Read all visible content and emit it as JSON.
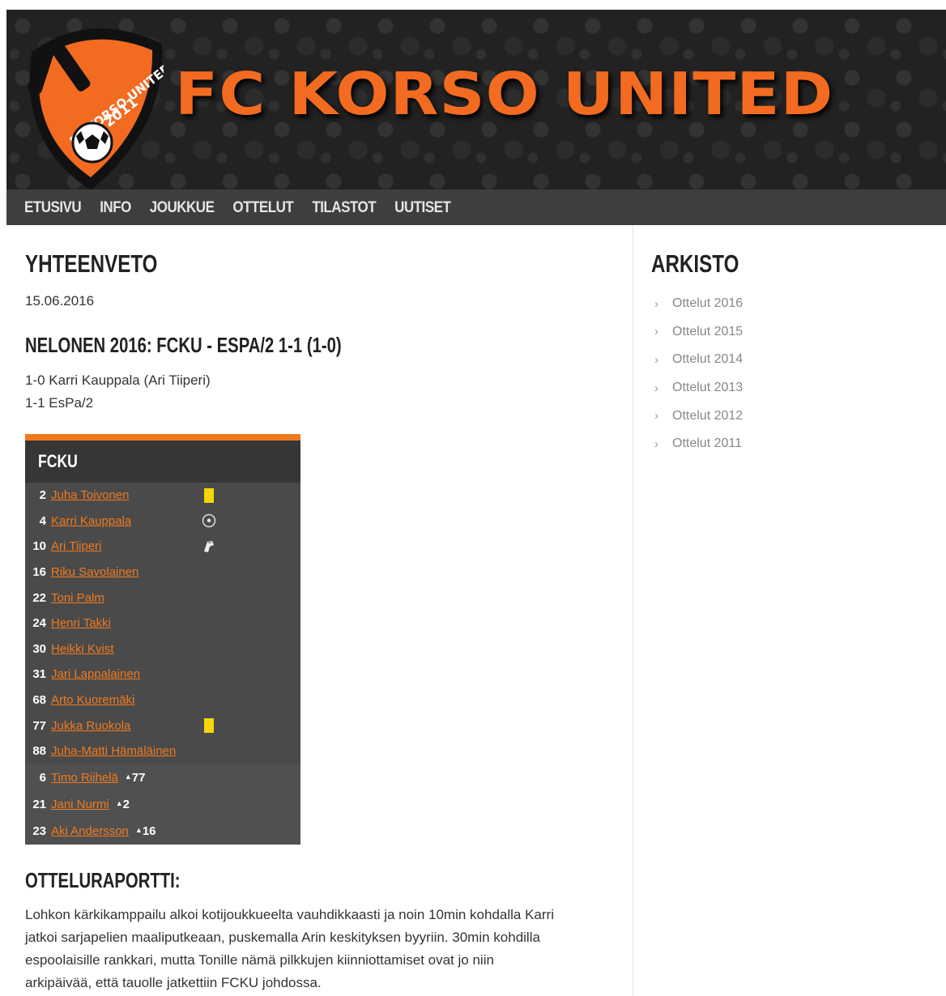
{
  "site": {
    "title": "FC KORSO UNITED",
    "logo_text": "FC KORSO UNITED",
    "logo_year": "2011"
  },
  "nav": [
    "ETUSIVU",
    "INFO",
    "JOUKKUE",
    "OTTELUT",
    "TILASTOT",
    "UUTISET"
  ],
  "main": {
    "heading": "YHTEENVETO",
    "date": "15.06.2016",
    "match_title": "NELONEN 2016: FCKU - ESPA/2 1-1 (1-0)",
    "goals": [
      "1-0 Karri Kauppala (Ari Tiiperi)",
      "1-1 EsPa/2"
    ],
    "lineup_team": "FCKU",
    "players": [
      {
        "num": "2",
        "name": "Juha Toivonen",
        "event": "yellow-card"
      },
      {
        "num": "4",
        "name": "Karri Kauppala",
        "event": "goal"
      },
      {
        "num": "10",
        "name": "Ari Tiiperi",
        "event": "assist"
      },
      {
        "num": "16",
        "name": "Riku Savolainen",
        "event": ""
      },
      {
        "num": "22",
        "name": "Toni Palm",
        "event": ""
      },
      {
        "num": "24",
        "name": "Henri Takki",
        "event": ""
      },
      {
        "num": "30",
        "name": "Heikki Kvist",
        "event": ""
      },
      {
        "num": "31",
        "name": "Jari Lappalainen",
        "event": ""
      },
      {
        "num": "68",
        "name": "Arto Kuoremäki",
        "event": ""
      },
      {
        "num": "77",
        "name": "Jukka Ruokola",
        "event": "yellow-card"
      },
      {
        "num": "88",
        "name": "Juha-Matti Hämäläinen",
        "event": ""
      }
    ],
    "subs": [
      {
        "num": "6",
        "name": "Timo Riihelä",
        "sub_for": "77"
      },
      {
        "num": "21",
        "name": "Jani Nurmi",
        "sub_for": "2"
      },
      {
        "num": "23",
        "name": "Aki Andersson",
        "sub_for": "16"
      }
    ],
    "report_heading": "OTTELURAPORTTI:",
    "report_lines": [
      "Lohkon kärkikamppailu alkoi kotijoukkueelta vauhdikkaasti ja noin 10min kohdalla Karri",
      "jatkoi sarjapelien maaliputkeaan, puskemalla Arin keskityksen byyriin. 30min kohdilla",
      "espoolaisille rankkari, mutta Tonille nämä pilkkujen kiinniottamiset ovat jo niin",
      "arkipäivää, että tauolle jatkettiin FCKU johdossa."
    ]
  },
  "sidebar": {
    "heading": "ARKISTO",
    "items": [
      "Ottelut 2016",
      "Ottelut 2015",
      "Ottelut 2014",
      "Ottelut 2013",
      "Ottelut 2012",
      "Ottelut 2011"
    ]
  },
  "colors": {
    "accent": "#f07a1f",
    "nav_bg": "#3e3e3e",
    "table_bg": "#4a4a4a",
    "yellow_card": "#f5d60a"
  }
}
